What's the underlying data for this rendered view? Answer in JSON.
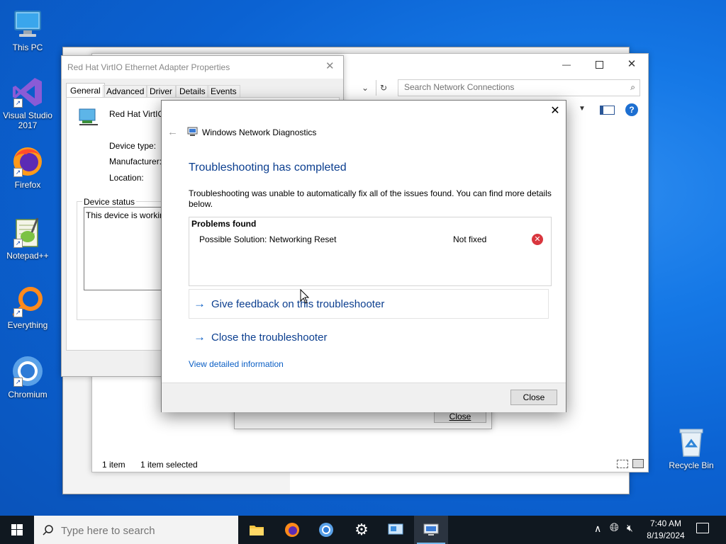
{
  "desktop": {
    "icons": [
      {
        "label": "This PC"
      },
      {
        "label": "Visual Studio 2017"
      },
      {
        "label": "Firefox"
      },
      {
        "label": "Notepad++"
      },
      {
        "label": "Everything"
      },
      {
        "label": "Chromium"
      },
      {
        "label": "Recycle Bin"
      }
    ]
  },
  "explorer": {
    "search_placeholder": "Search Network Connections",
    "status_count": "1 item",
    "status_selected": "1 item selected"
  },
  "props": {
    "title": "Red Hat VirtIO Ethernet Adapter Properties",
    "tabs": [
      "General",
      "Advanced",
      "Driver",
      "Details",
      "Events"
    ],
    "device_name": "Red Hat VirtIO E",
    "device_type_label": "Device type:",
    "manufacturer_label": "Manufacturer:",
    "location_label": "Location:",
    "status_group": "Device status",
    "status_text": "This device is working",
    "close_label": "Close"
  },
  "diag": {
    "title": "Windows Network Diagnostics",
    "heading": "Troubleshooting has completed",
    "desc": "Troubleshooting was unable to automatically fix all of the issues found. You can find more details below.",
    "problems_header": "Problems found",
    "problem": {
      "name": "Possible Solution: Networking Reset",
      "status": "Not fixed"
    },
    "feedback_link": "Give feedback on this troubleshooter",
    "close_link": "Close the troubleshooter",
    "detail_link": "View detailed information",
    "close_button": "Close"
  },
  "taskbar": {
    "search_placeholder": "Type here to search",
    "time": "7:40 AM",
    "date": "8/19/2024"
  },
  "colors": {
    "accent": "#0b3e8f",
    "link": "#0b5fc5",
    "error": "#d9363e"
  }
}
